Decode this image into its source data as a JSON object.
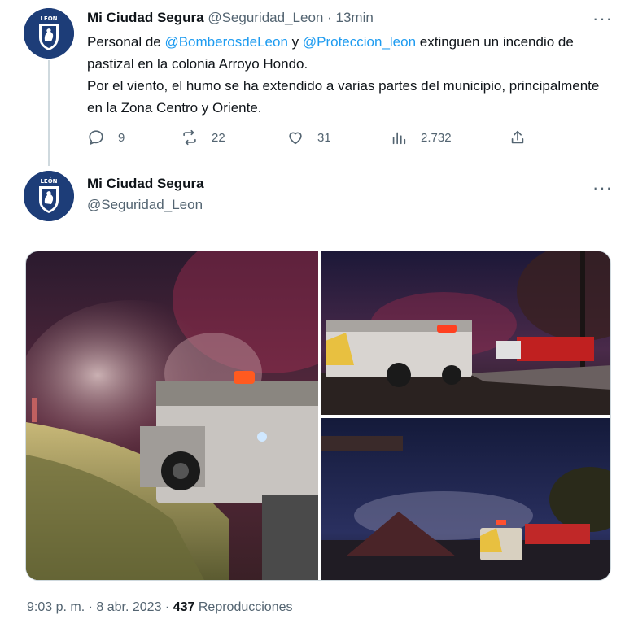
{
  "tweet1": {
    "display_name": "Mi Ciudad Segura",
    "handle": "@Seguridad_Leon",
    "separator": "·",
    "time_ago": "13min",
    "text_parts": {
      "prefix": "Personal de ",
      "mention1": "@BomberosdeLeon",
      "middle": " y ",
      "mention2": "@Proteccion_leon",
      "after_mentions": " extinguen un incendio de pastizal en la colonia Arroyo Hondo.",
      "line2": "Por el viento, el humo se ha extendido a varias partes del municipio, principalmente en la Zona Centro y Oriente."
    },
    "more_label": "···",
    "actions": {
      "replies": "9",
      "retweets": "22",
      "likes": "31",
      "views": "2.732"
    }
  },
  "tweet2": {
    "display_name": "Mi Ciudad Segura",
    "handle": "@Seguridad_Leon",
    "more_label": "···"
  },
  "footer": {
    "time": "9:03 p. m.",
    "separator": "·",
    "date": "8 abr. 2023",
    "separator2": "·",
    "views_count": "437",
    "views_label": "Reproducciones"
  },
  "avatar_text": "LEÓN",
  "colors": {
    "link": "#1d9bf0",
    "secondary_text": "#536471",
    "avatar_bg": "#1d3d78"
  },
  "icons": [
    "reply-icon",
    "retweet-icon",
    "like-icon",
    "views-icon",
    "share-icon",
    "more-icon"
  ]
}
